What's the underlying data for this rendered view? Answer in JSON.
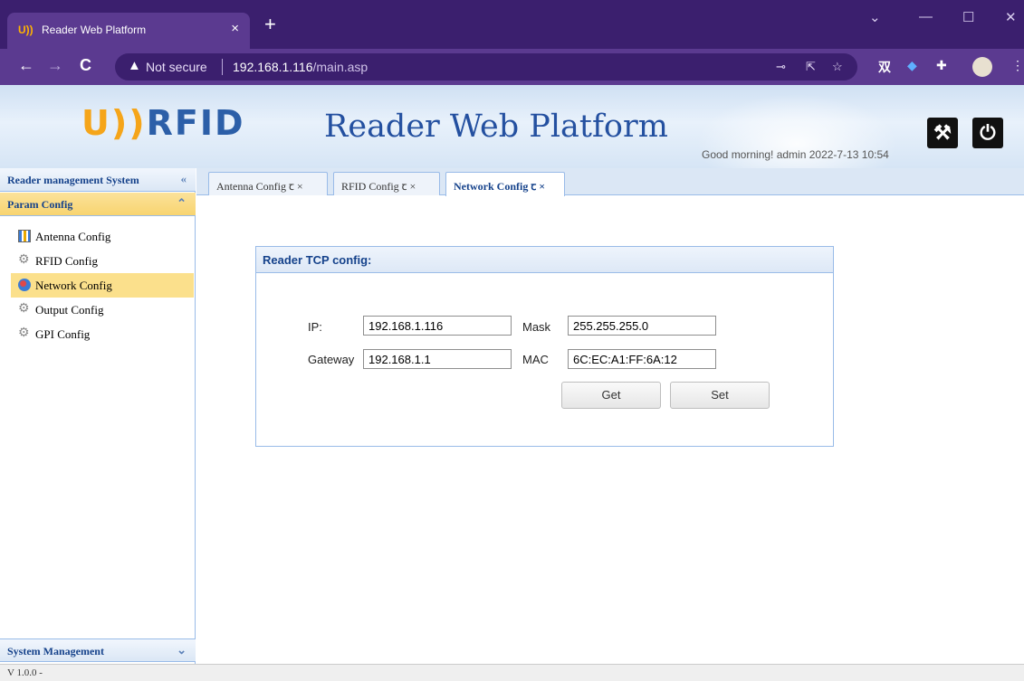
{
  "browser": {
    "tab_favicon": "U))",
    "tab_title": "Reader Web Platform",
    "tab_close": "×",
    "new_tab": "+",
    "not_secure": "Not secure",
    "url_host": "192.168.1.116",
    "url_path": "/main.asp"
  },
  "banner": {
    "logo_u": "U))",
    "logo_rfid": "RFID",
    "title": "Reader Web Platform",
    "greeting": "Good morning! admin  2022-7-13 10:54"
  },
  "sidebar": {
    "header": "Reader management System",
    "section_param": "Param Config",
    "items": [
      {
        "label": "Antenna Config",
        "icon": "antenna-icon"
      },
      {
        "label": "RFID Config",
        "icon": "gear-icon"
      },
      {
        "label": "Network Config",
        "icon": "globe-icon"
      },
      {
        "label": "Output Config",
        "icon": "gear-icon"
      },
      {
        "label": "GPI Config",
        "icon": "gear-icon"
      }
    ],
    "section_system": "System Management"
  },
  "tabs": [
    {
      "label": "Antenna Config ꞇ ×"
    },
    {
      "label": "RFID Config ꞇ ×"
    },
    {
      "label": "Network Config ꞇ ×"
    }
  ],
  "panel": {
    "title": "Reader TCP config:",
    "ip_label": "IP:",
    "ip_value": "192.168.1.116",
    "mask_label": "Mask",
    "mask_value": "255.255.255.0",
    "gateway_label": "Gateway",
    "gateway_value": "192.168.1.1",
    "mac_label": "MAC",
    "mac_value": "6C:EC:A1:FF:6A:12",
    "get_label": "Get",
    "set_label": "Set"
  },
  "status": {
    "version": "V 1.0.0 -"
  },
  "colors": {
    "accent": "#15428b",
    "active_item": "#fbe08c",
    "browser_frame": "#3b1f6e"
  }
}
